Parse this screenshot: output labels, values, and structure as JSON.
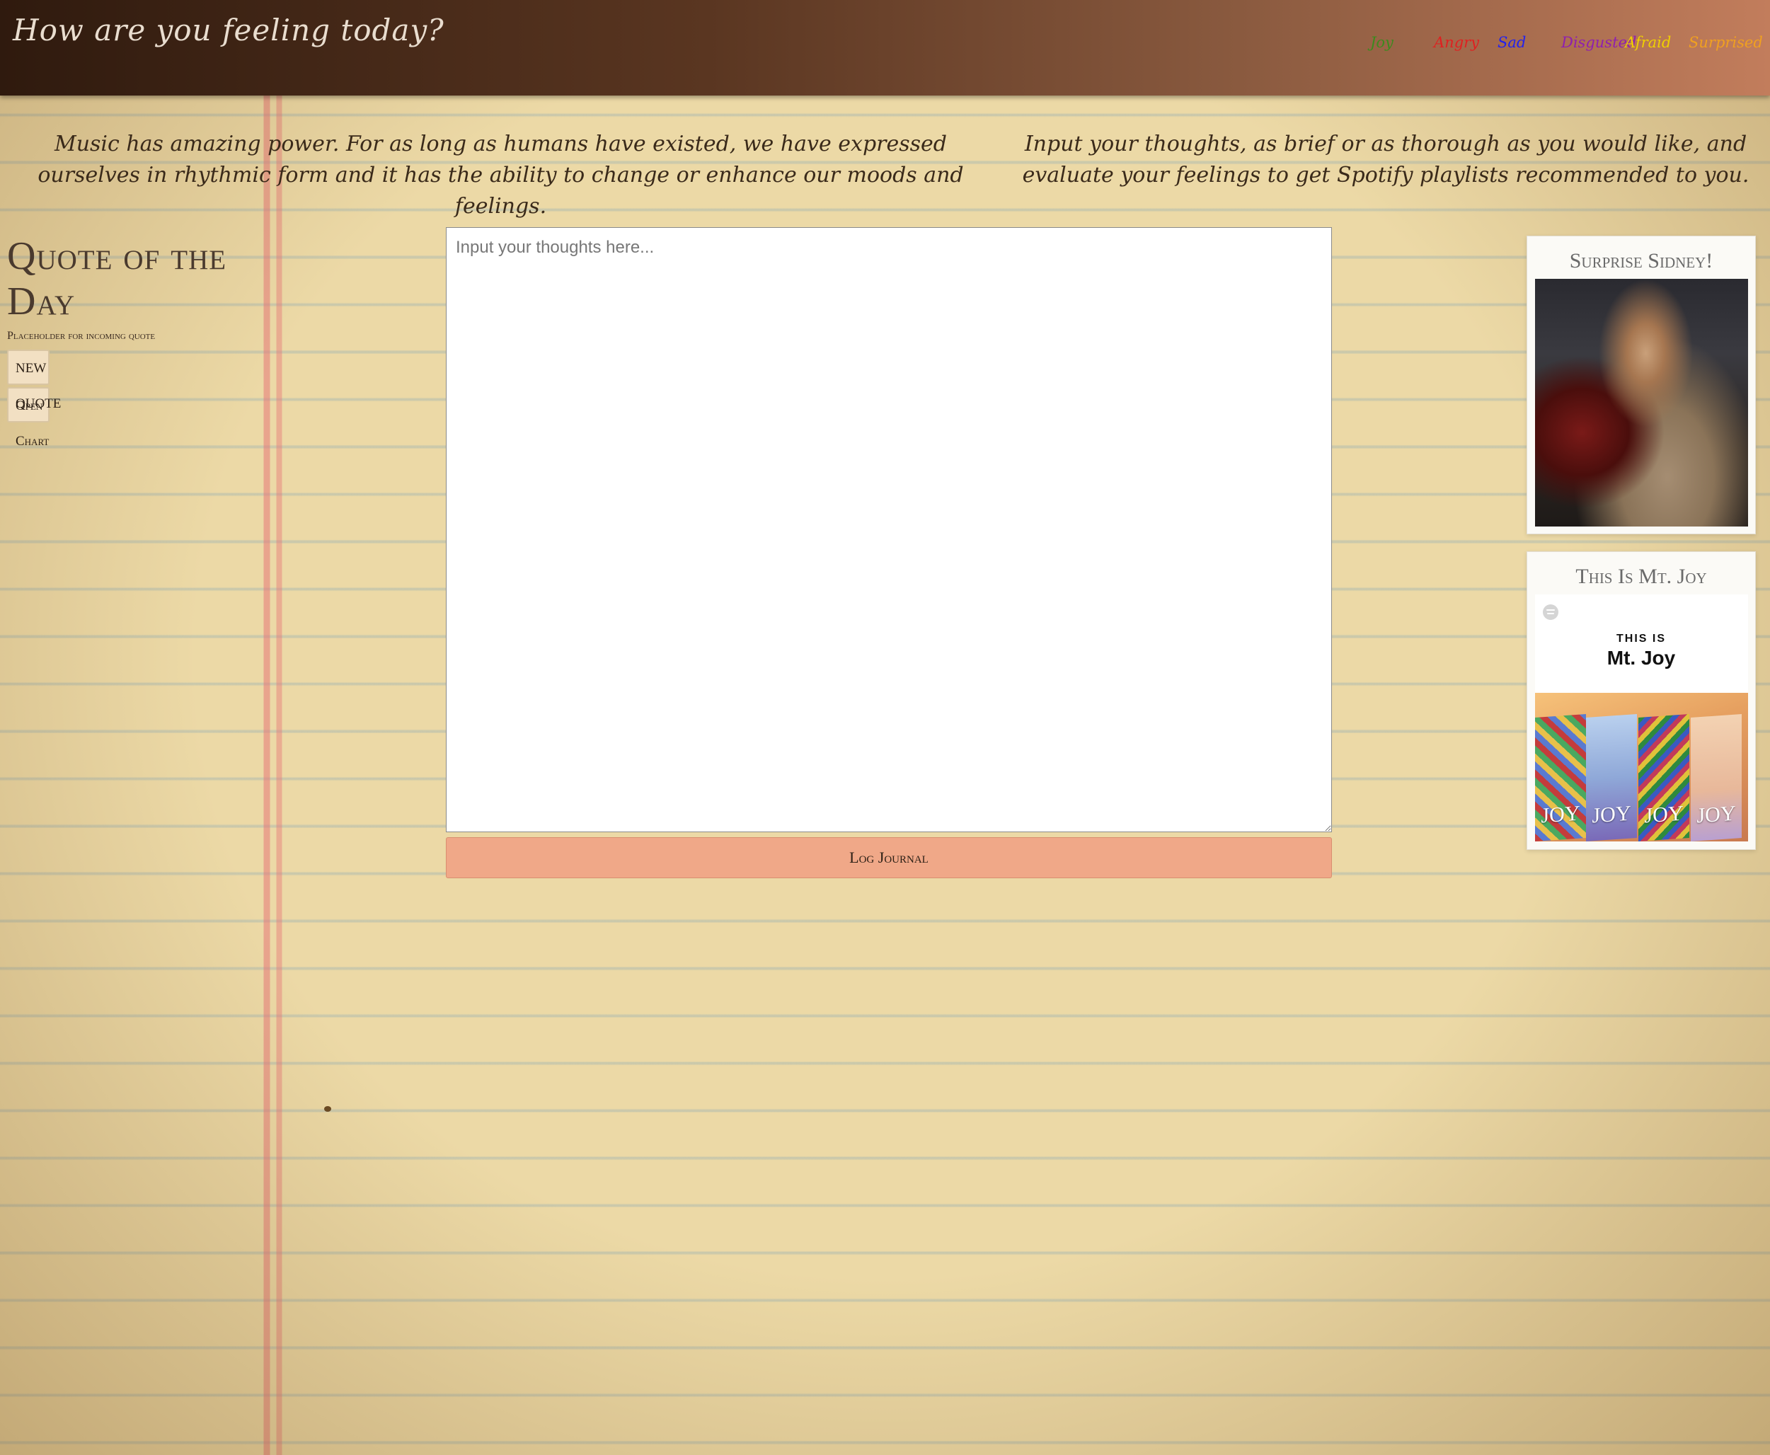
{
  "header": {
    "title": "How are you feeling today?",
    "emotions": [
      {
        "label": "Joy",
        "color": "#3c8a1e"
      },
      {
        "label": "Angry",
        "color": "#e02020"
      },
      {
        "label": "Sad",
        "color": "#2222ee"
      },
      {
        "label": "Disgusted",
        "color": "#8e1fb0"
      },
      {
        "label": "Afraid",
        "color": "#f0d000"
      },
      {
        "label": "Surprised",
        "color": "#f0a020"
      }
    ]
  },
  "intro": {
    "left": "Music has amazing power. For as long as humans have existed, we have expressed ourselves in rhythmic form and it has the ability to change or enhance our moods and feelings.",
    "right": "Input your thoughts, as brief or as thorough as you would like, and evaluate your feelings to get Spotify playlists recommended to you."
  },
  "quote": {
    "title": "Quote of the Day",
    "text": "Placeholder for incoming quote",
    "new_quote_label": "NEW QUOTE",
    "open_chart_label": "Open Chart"
  },
  "journal": {
    "placeholder": "Input your thoughts here...",
    "value": "",
    "log_label": "Log Journal"
  },
  "playlists": [
    {
      "title": "Surprise Sidney!",
      "image": "movie-still-image"
    },
    {
      "title": "This Is Mt. Joy",
      "image": "playlist-cover-image",
      "cover_this_is": "THIS IS",
      "cover_name": "Mt. Joy",
      "album_text": "JOY",
      "album_text_2": "JOY",
      "album_text_3": "JOY",
      "album_text_4": "JOY"
    }
  ]
}
